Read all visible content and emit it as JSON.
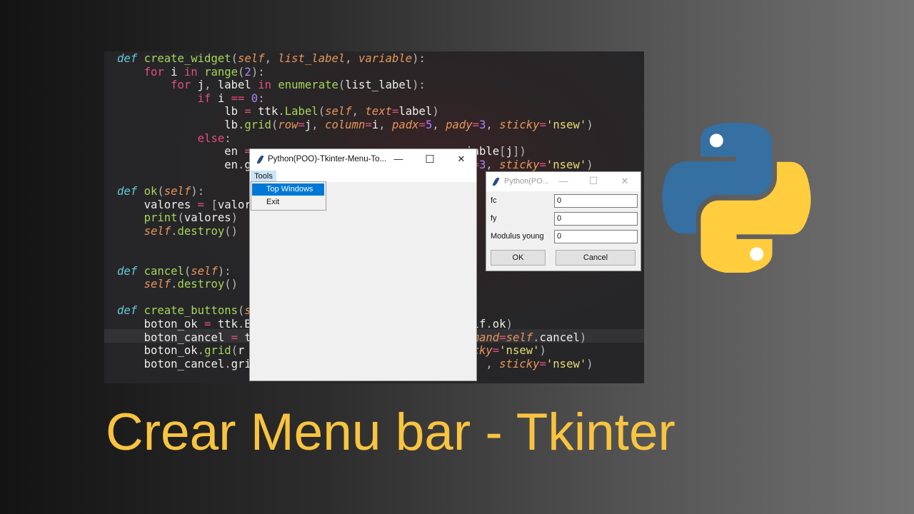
{
  "code": {
    "lines": [
      "def create_widget(self, list_label, variable):",
      "    for i in range(2):",
      "        for j, label in enumerate(list_label):",
      "            if i == 0:",
      "                lb = ttk.Label(self, text=label)",
      "                lb.grid(row=j, column=i, padx=5, pady=3, sticky='nsew')",
      "            else:",
      "                en =                                iable[j])",
      "                en.g                                 =3, sticky='nsew')",
      "",
      "def ok(self):",
      "    valores = [valor",
      "    print(valores)",
      "    self.destroy()",
      "",
      "",
      "def cancel(self):",
      "    self.destroy()",
      "",
      "def create_buttons(s",
      "    boton_ok = ttk.B                                 lf.ok)",
      "    boton_cancel = t                                mmand=self.cancel)",
      "    boton_ok.grid(r                                 icky='nsew')",
      "    boton_cancel.gri                                   , sticky='nsew')"
    ]
  },
  "main_window": {
    "title": "Python(POO)-Tkinter-Menu-To...",
    "minimize": "—",
    "maximize": "☐",
    "close": "✕",
    "menu": {
      "label": "Tools",
      "items": [
        "Top Windows",
        "Exit"
      ],
      "active_item": "Top Windows"
    }
  },
  "dialog": {
    "title": "Python(PO...",
    "minimize": "—",
    "maximize": "☐",
    "close": "✕",
    "fields": [
      {
        "label": "fc",
        "value": "0"
      },
      {
        "label": "fy",
        "value": "0"
      },
      {
        "label": "Modulus young",
        "value": "0"
      }
    ],
    "ok_label": "OK",
    "cancel_label": "Cancel"
  },
  "logo": {
    "name": "python-logo",
    "blue": "#366fa2",
    "yellow": "#ffcd3d"
  },
  "headline": "Crear Menu bar - Tkinter",
  "colors": {
    "headline": "#f8c440",
    "menu_highlight": "#0078d7"
  }
}
